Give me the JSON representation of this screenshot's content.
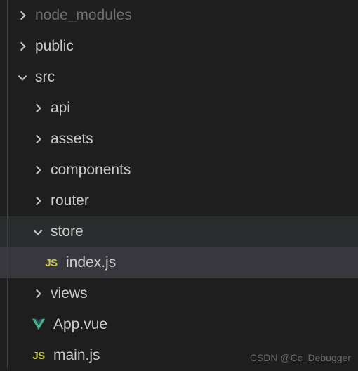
{
  "tree": {
    "node_modules": {
      "label": "node_modules",
      "expanded": false
    },
    "public": {
      "label": "public",
      "expanded": false
    },
    "src": {
      "label": "src",
      "expanded": true
    },
    "api": {
      "label": "api",
      "expanded": false
    },
    "assets": {
      "label": "assets",
      "expanded": false
    },
    "components": {
      "label": "components",
      "expanded": false
    },
    "router": {
      "label": "router",
      "expanded": false
    },
    "store": {
      "label": "store",
      "expanded": true
    },
    "index_js": {
      "label": "index.js"
    },
    "views": {
      "label": "views",
      "expanded": false
    },
    "app_vue": {
      "label": "App.vue"
    },
    "main_js": {
      "label": "main.js"
    }
  },
  "icons": {
    "js": "JS"
  },
  "watermark": "CSDN @Cc_Debugger"
}
